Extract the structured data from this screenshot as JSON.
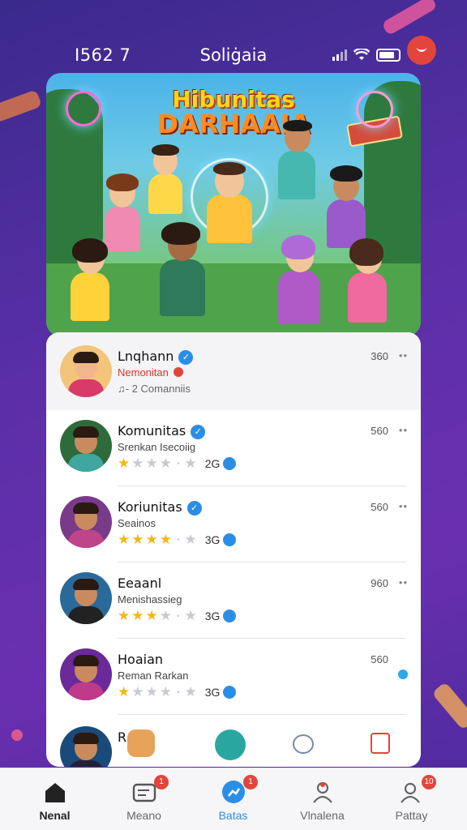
{
  "status_bar": {
    "time": "I562 7",
    "title": "Soliġaia"
  },
  "hero": {
    "title_line1": "Hibunitas",
    "title_line2": "DARHAAIA"
  },
  "list": [
    {
      "name": "Lnqhann",
      "subtitle": "Nemonitan",
      "meta": "♫- 2 Comanniis",
      "time": "360",
      "rating": 0,
      "avatar_bg": "#f4c47a",
      "shirt": "#d83a6a"
    },
    {
      "name": "Komunitas",
      "subtitle": "Srenkan Isecoiig",
      "count": "2G",
      "time": "560",
      "rating": 1,
      "avatar_bg": "#2f6b3a",
      "shirt": "#3fa6a0"
    },
    {
      "name": "Koriunitas",
      "subtitle": "Seainos",
      "count": "3G",
      "time": "560",
      "rating": 4,
      "avatar_bg": "#7a3a8a",
      "shirt": "#c0448a"
    },
    {
      "name": "Eeaanl",
      "subtitle": "Menishassieg",
      "count": "3G",
      "time": "960",
      "rating": 3,
      "avatar_bg": "#2a6a9a",
      "shirt": "#222"
    },
    {
      "name": "Hoaian",
      "subtitle": "Reman Rarkan",
      "count": "3G",
      "time": "560",
      "rating": 1,
      "avatar_bg": "#6a2a9a",
      "shirt": "#c03a8a"
    },
    {
      "name": "Rc",
      "subtitle": "",
      "time": "",
      "rating": 0,
      "avatar_bg": "#1a4a7a",
      "shirt": "#223"
    }
  ],
  "tabs": [
    {
      "label": "Nenal",
      "icon": "home-icon",
      "badge": ""
    },
    {
      "label": "Meano",
      "icon": "message-icon",
      "badge": "1"
    },
    {
      "label": "Batas",
      "icon": "running-icon",
      "badge": "1"
    },
    {
      "label": "Vlnalena",
      "icon": "profile-icon",
      "badge": ""
    },
    {
      "label": "Pattay",
      "icon": "people-icon",
      "badge": "10"
    }
  ],
  "colors": {
    "accent": "#2b8ee6",
    "alert": "#e2453b",
    "star": "#f6b617"
  }
}
